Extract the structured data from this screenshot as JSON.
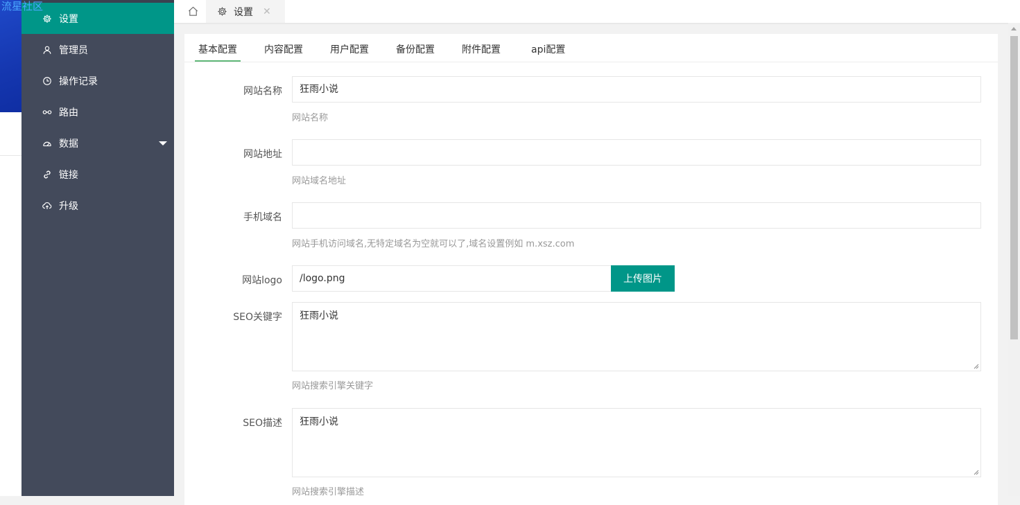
{
  "watermark": "流星社区",
  "sidebar": {
    "items": [
      {
        "label": "设置",
        "icon": "gear-icon"
      },
      {
        "label": "管理员",
        "icon": "user-icon"
      },
      {
        "label": "操作记录",
        "icon": "clock-icon"
      },
      {
        "label": "路由",
        "icon": "route-icon"
      },
      {
        "label": "数据",
        "icon": "dashboard-icon"
      },
      {
        "label": "链接",
        "icon": "link-icon"
      },
      {
        "label": "升级",
        "icon": "cloud-upload-icon"
      }
    ]
  },
  "tabbar": {
    "active_tab": "设置",
    "close_glyph": "✕"
  },
  "config_tabs": [
    "基本配置",
    "内容配置",
    "用户配置",
    "备份配置",
    "附件配置",
    "api配置"
  ],
  "form": {
    "site_name": {
      "label": "网站名称",
      "value": "狂雨小说",
      "hint": "网站名称"
    },
    "site_url": {
      "label": "网站地址",
      "value": "",
      "hint": "网站域名地址"
    },
    "mobile_domain": {
      "label": "手机域名",
      "value": "",
      "hint": "网站手机访问域名,无特定域名为空就可以了,域名设置例如 m.xsz.com"
    },
    "site_logo": {
      "label": "网站logo",
      "value": "/logo.png",
      "button": "上传图片"
    },
    "seo_keywords": {
      "label": "SEO关键字",
      "value": "狂雨小说",
      "hint": "网站搜索引擎关键字"
    },
    "seo_description": {
      "label": "SEO描述",
      "value": "狂雨小说",
      "hint": "网站搜索引擎描述"
    }
  },
  "colors": {
    "sidebar_bg": "#434a5b",
    "accent": "#009688",
    "tab_underline": "#5fb878"
  }
}
